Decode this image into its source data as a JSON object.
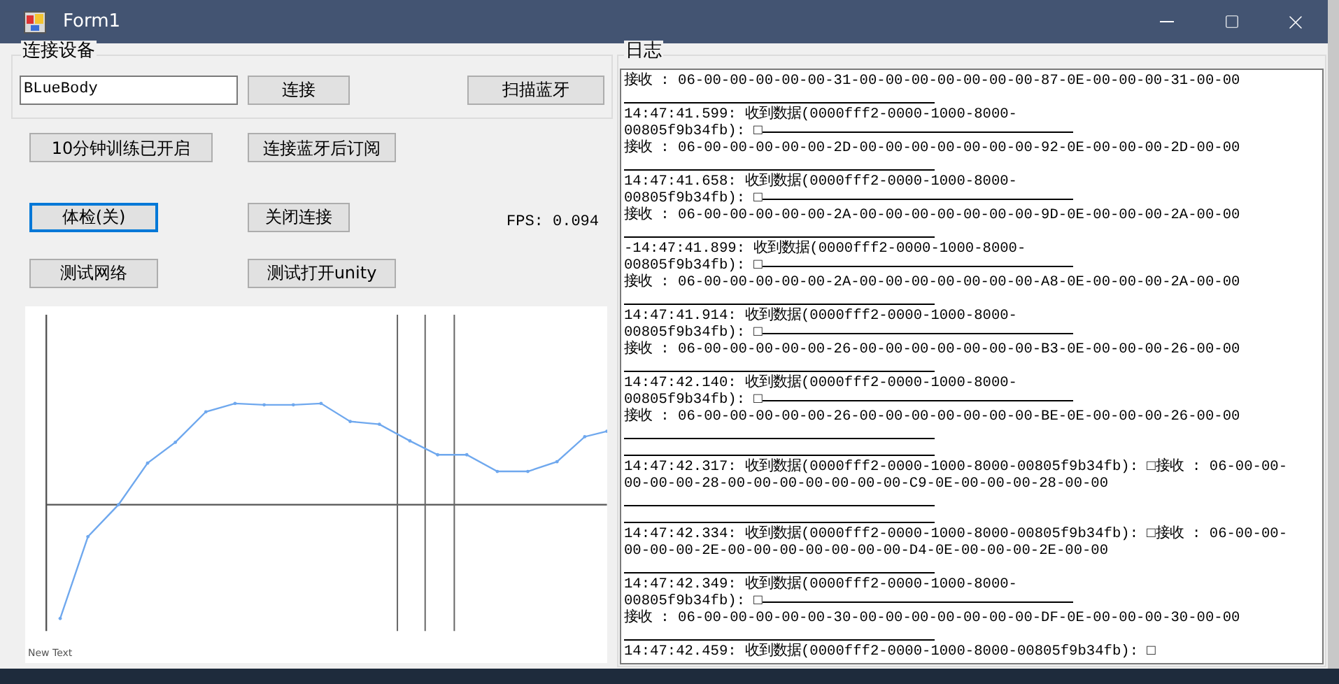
{
  "window": {
    "title": "Form1"
  },
  "device_group": {
    "title": "连接设备",
    "device_field": {
      "value": "BLueBody"
    },
    "connect_button": {
      "label": "连接",
      "focused": false
    },
    "scan_button": {
      "label": "扫描蓝牙",
      "focused": false
    }
  },
  "control_rows": [
    {
      "buttons": [
        {
          "label": "10分钟训练已开启",
          "focused": false
        },
        {
          "label": "连接蓝牙后订阅",
          "focused": false
        }
      ]
    },
    {
      "buttons": [
        {
          "label": "体检(关)",
          "focused": true
        },
        {
          "label": "关闭连接",
          "focused": false
        }
      ],
      "status": "FPS: 0.094"
    },
    {
      "buttons": [
        {
          "label": "测试网络",
          "focused": false
        },
        {
          "label": "测试打开unity",
          "focused": false
        }
      ]
    }
  ],
  "chart": {
    "caption": "New Text"
  },
  "log_group": {
    "title": "日志",
    "lines": [
      {
        "kind": "text",
        "text": "接收 : 06-00-00-00-00-00-31-00-00-00-00-00-00-00-87-0E-00-00-00-31-00-00"
      },
      {
        "kind": "rule"
      },
      {
        "kind": "text",
        "text": "14:47:41.599: 收到数据(0000fff2-0000-1000-8000-"
      },
      {
        "kind": "text_rule",
        "text": "00805f9b34fb): □"
      },
      {
        "kind": "text",
        "text": "接收 : 06-00-00-00-00-00-2D-00-00-00-00-00-00-00-92-0E-00-00-00-2D-00-00"
      },
      {
        "kind": "rule"
      },
      {
        "kind": "text",
        "text": "14:47:41.658: 收到数据(0000fff2-0000-1000-8000-"
      },
      {
        "kind": "text_rule",
        "text": "00805f9b34fb): □"
      },
      {
        "kind": "text",
        "text": "接收 : 06-00-00-00-00-00-2A-00-00-00-00-00-00-00-9D-0E-00-00-00-2A-00-00"
      },
      {
        "kind": "rule"
      },
      {
        "kind": "text",
        "text": "-14:47:41.899: 收到数据(0000fff2-0000-1000-8000-"
      },
      {
        "kind": "text_rule",
        "text": "00805f9b34fb): □"
      },
      {
        "kind": "text",
        "text": "接收 : 06-00-00-00-00-00-2A-00-00-00-00-00-00-00-A8-0E-00-00-00-2A-00-00"
      },
      {
        "kind": "rule"
      },
      {
        "kind": "text",
        "text": "14:47:41.914: 收到数据(0000fff2-0000-1000-8000-"
      },
      {
        "kind": "text_rule",
        "text": "00805f9b34fb): □"
      },
      {
        "kind": "text",
        "text": "接收 : 06-00-00-00-00-00-26-00-00-00-00-00-00-00-B3-0E-00-00-00-26-00-00"
      },
      {
        "kind": "rule"
      },
      {
        "kind": "text",
        "text": "14:47:42.140: 收到数据(0000fff2-0000-1000-8000-"
      },
      {
        "kind": "text_rule",
        "text": "00805f9b34fb): □"
      },
      {
        "kind": "text",
        "text": "接收 : 06-00-00-00-00-00-26-00-00-00-00-00-00-00-BE-0E-00-00-00-26-00-00"
      },
      {
        "kind": "rule"
      },
      {
        "kind": "rule"
      },
      {
        "kind": "text",
        "text": "14:47:42.317: 收到数据(0000fff2-0000-1000-8000-00805f9b34fb): □接收 : 06-00-00-"
      },
      {
        "kind": "text",
        "text": "00-00-00-28-00-00-00-00-00-00-00-C9-0E-00-00-00-28-00-00"
      },
      {
        "kind": "rule"
      },
      {
        "kind": "rule"
      },
      {
        "kind": "text",
        "text": "14:47:42.334: 收到数据(0000fff2-0000-1000-8000-00805f9b34fb): □接收 : 06-00-00-"
      },
      {
        "kind": "text",
        "text": "00-00-00-2E-00-00-00-00-00-00-00-D4-0E-00-00-00-2E-00-00"
      },
      {
        "kind": "rule"
      },
      {
        "kind": "text",
        "text": "14:47:42.349: 收到数据(0000fff2-0000-1000-8000-"
      },
      {
        "kind": "text_rule",
        "text": "00805f9b34fb): □"
      },
      {
        "kind": "text",
        "text": "接收 : 06-00-00-00-00-00-30-00-00-00-00-00-00-00-DF-0E-00-00-00-30-00-00"
      },
      {
        "kind": "rule"
      },
      {
        "kind": "text",
        "text": "14:47:42.459: 收到数据(0000fff2-0000-1000-8000-00805f9b34fb): □"
      }
    ]
  }
}
